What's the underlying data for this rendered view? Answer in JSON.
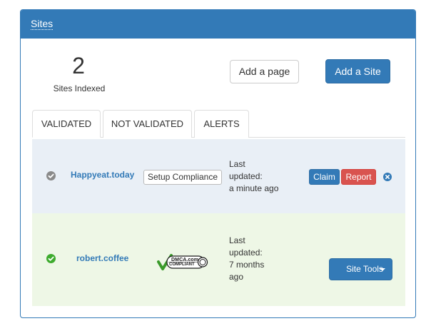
{
  "panel": {
    "title": "Sites"
  },
  "summary": {
    "count": "2",
    "count_label": "Sites Indexed"
  },
  "actions": {
    "add_page": "Add a page",
    "add_site": "Add a Site"
  },
  "tabs": [
    {
      "label": "VALIDATED",
      "active": true
    },
    {
      "label": "NOT VALIDATED",
      "active": false
    },
    {
      "label": "ALERTS",
      "active": false
    }
  ],
  "sites": [
    {
      "name": "Happyeat.today",
      "status": "pending",
      "status_icon": "check-circle-gray-icon",
      "compliance_button": "Setup Compliance",
      "updated_lines": [
        "Last",
        "updated:",
        "a minute ago"
      ],
      "claim_label": "Claim",
      "report_label": "Report",
      "remove_icon": "close-circle-icon"
    },
    {
      "name": "robert.coffee",
      "status": "validated",
      "status_icon": "check-circle-green-icon",
      "badge_top": "DMCA.com",
      "badge_bottom": "COMPLIANT",
      "updated_lines": [
        "Last",
        "updated:",
        "7 months",
        "ago"
      ],
      "tools_label": "Site Tools"
    }
  ],
  "colors": {
    "primary": "#337ab7",
    "danger": "#d9534f",
    "success": "#3eab2e",
    "row_pending_bg": "#e9eff6",
    "row_validated_bg": "#eef7e6"
  }
}
